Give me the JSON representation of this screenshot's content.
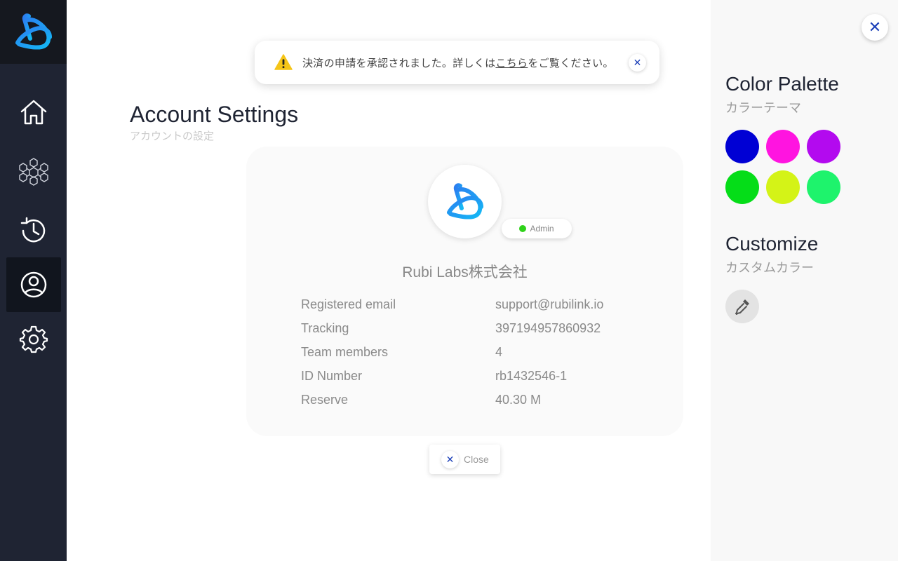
{
  "toast": {
    "message_before": "決済の申請を承認されました。詳しくは",
    "link_text": "こちら",
    "message_after": "をご覧ください。",
    "close_glyph": "✕"
  },
  "header": {
    "title": "Account Settings",
    "subtitle": "アカウントの設定"
  },
  "sidebar": {
    "items": [
      {
        "icon": "home-icon"
      },
      {
        "icon": "network-cubes-icon"
      },
      {
        "icon": "history-icon"
      },
      {
        "icon": "user-profile-icon",
        "active": true
      },
      {
        "icon": "gear-icon"
      }
    ]
  },
  "profile": {
    "role": "Admin",
    "role_color": "#2fd21a",
    "company": "Rubi Labs株式会社",
    "fields": [
      {
        "label": "Registered email",
        "value": "support@rubilink.io"
      },
      {
        "label": "Tracking",
        "value": "397194957860932"
      },
      {
        "label": "Team members",
        "value": "4"
      },
      {
        "label": "ID Number",
        "value": "rb1432546-1"
      },
      {
        "label": "Reserve",
        "value": "40.30 M"
      }
    ],
    "close_label": "Close",
    "close_glyph": "✕"
  },
  "panel": {
    "close_glyph": "✕",
    "palette_title": "Color Palette",
    "palette_subtitle": "カラーテーマ",
    "swatches": [
      "#0000d4",
      "#ff14e0",
      "#b30aef",
      "#05dd18",
      "#d4f317",
      "#1ef36c"
    ],
    "customize_title": "Customize",
    "customize_subtitle": "カスタムカラー"
  }
}
